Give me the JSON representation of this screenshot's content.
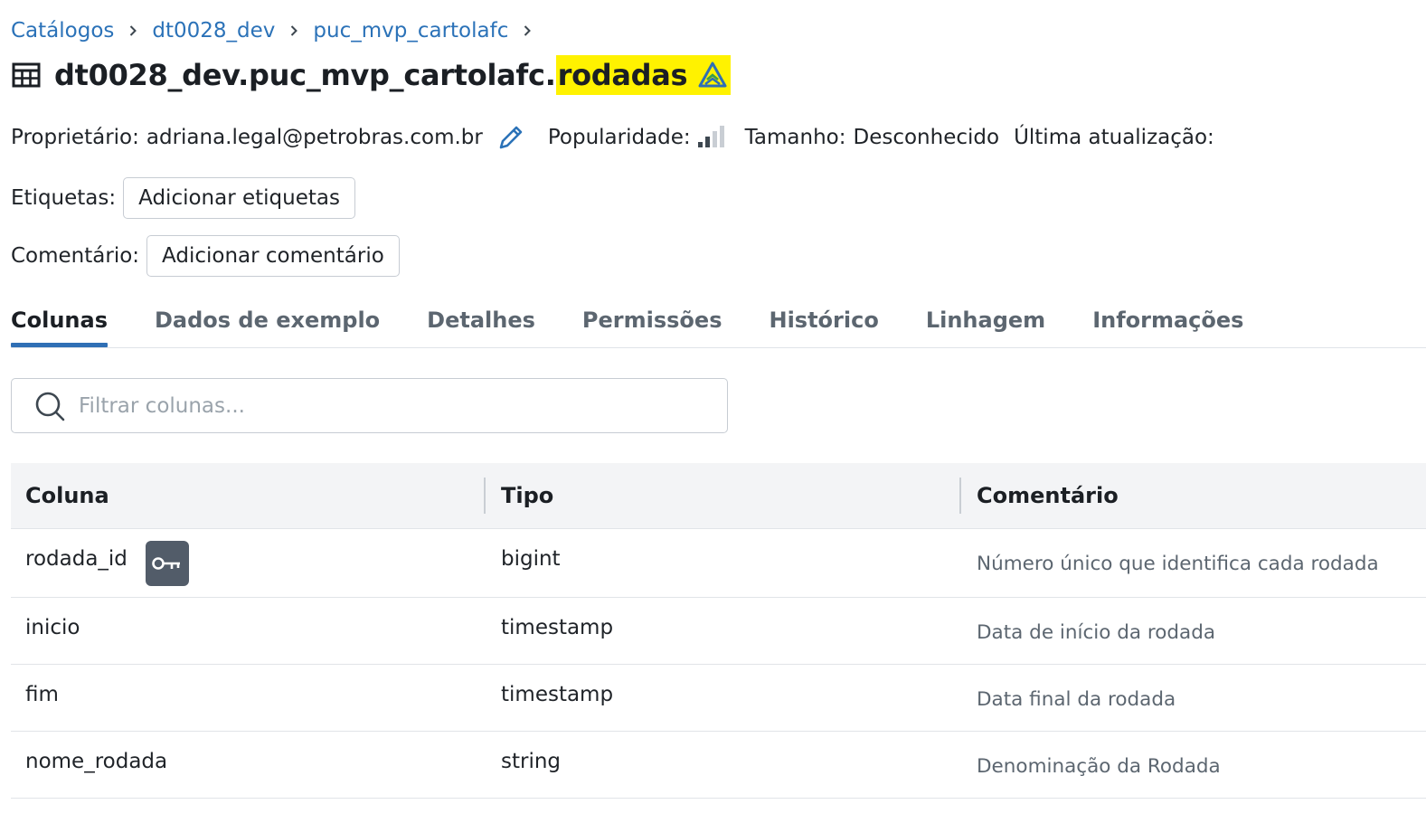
{
  "breadcrumb": {
    "items": [
      "Catálogos",
      "dt0028_dev",
      "puc_mvp_cartolafc"
    ]
  },
  "title": {
    "prefix": "dt0028_dev.puc_mvp_cartolafc.",
    "highlighted": "rodadas"
  },
  "meta": {
    "owner_label": "Proprietário:",
    "owner_value": "adriana.legal@petrobras.com.br",
    "popularity_label": "Popularidade:",
    "size_label": "Tamanho:",
    "size_value": "Desconhecido",
    "last_update_label": "Última atualização:"
  },
  "tags": {
    "label": "Etiquetas:",
    "button": "Adicionar etiquetas"
  },
  "comment": {
    "label": "Comentário:",
    "button": "Adicionar comentário"
  },
  "tabs": [
    {
      "label": "Colunas",
      "active": true
    },
    {
      "label": "Dados de exemplo",
      "active": false
    },
    {
      "label": "Detalhes",
      "active": false
    },
    {
      "label": "Permissões",
      "active": false
    },
    {
      "label": "Histórico",
      "active": false
    },
    {
      "label": "Linhagem",
      "active": false
    },
    {
      "label": "Informações",
      "active": false
    }
  ],
  "search": {
    "placeholder": "Filtrar colunas..."
  },
  "table": {
    "headers": [
      "Coluna",
      "Tipo",
      "Comentário"
    ],
    "rows": [
      {
        "name": "rodada_id",
        "type": "bigint",
        "comment": "Número único que identifica cada rodada",
        "primary_key": true
      },
      {
        "name": "inicio",
        "type": "timestamp",
        "comment": "Data de início da rodada",
        "primary_key": false
      },
      {
        "name": "fim",
        "type": "timestamp",
        "comment": "Data final da rodada",
        "primary_key": false
      },
      {
        "name": "nome_rodada",
        "type": "string",
        "comment": "Denominação da Rodada",
        "primary_key": false
      }
    ]
  },
  "colors": {
    "link": "#2b72b8",
    "highlight": "#fff200",
    "active_tab_underline": "#2f6fb5",
    "key_badge": "#525c69"
  }
}
